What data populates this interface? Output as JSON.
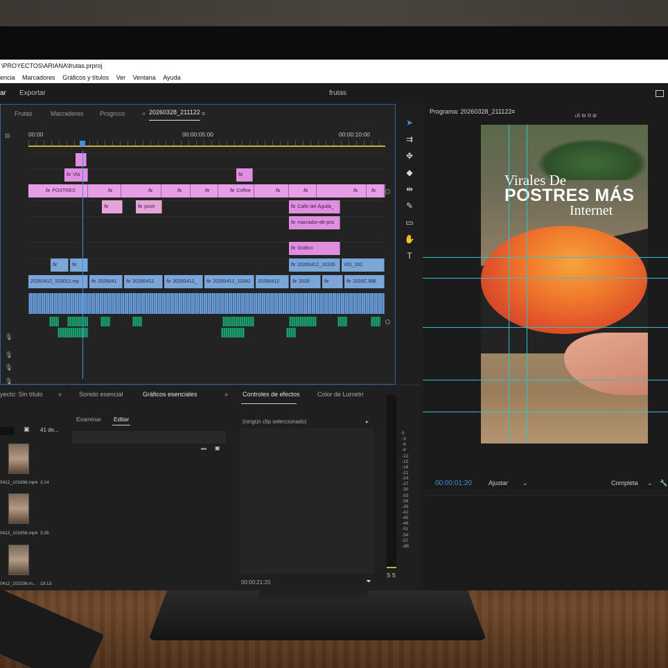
{
  "app": {
    "title_path": "\\PROYECTOS\\ARIANA\\frutas.prproj",
    "menu": [
      "encia",
      "Marcadores",
      "Gráficos y títulos",
      "Ver",
      "Ventana",
      "Ayuda"
    ],
    "modes": [
      "ar",
      "Exportar"
    ],
    "project_name": "frutas"
  },
  "timeline": {
    "tabs": [
      "Frutas",
      "Macraderes",
      "Progrcco"
    ],
    "active_tab": "20260328_211122",
    "menu_glyph": "≡",
    "timecodes": [
      "00:00",
      "00:00:05:00",
      "00:00:10:00"
    ],
    "clips": {
      "v_pink_a": "Vla",
      "v_main_1": "POSTRES",
      "v_main_2": "Coffee",
      "v_post": "postr",
      "v_calle": "Calle del Águila_",
      "v_marcador": "marcador-de-pos",
      "v_grafico": "Gráfico",
      "v_clip_a": "20260412_10165",
      "v_clip_b": "VID_202",
      "v_base_1": "20260412_103012.mp",
      "v_base_2": "2026041",
      "v_base_3": "20260412",
      "v_base_4": "20260412_",
      "v_base_5": "20260412_10342",
      "v_base_6": "20260412",
      "v_base_7": "2026",
      "v_base_8": "2026C BlB"
    },
    "fx_label": "fx"
  },
  "program": {
    "title": "Programa: 20260328_211122",
    "menu_glyph": "≡",
    "top_labels": "ʟE ₪     !0 ₪",
    "overlay_line1": "Virales De",
    "overlay_line2": "POSTRES MÁS",
    "overlay_line3": "Internet",
    "timecode": "00:00:01:20",
    "fit": "Ajustar",
    "resolution": "Completa"
  },
  "project_panel": {
    "title": "yecto: Sin título",
    "count": "41 de...",
    "items": [
      {
        "name": "0412_101698.mp4",
        "duration": "3:14"
      },
      {
        "name": "0412_101856.mp4",
        "duration": "3:26"
      },
      {
        "name": "0412_102338.m...",
        "duration": "19:13"
      }
    ]
  },
  "essential_panel": {
    "tabs": [
      "Sonido esencial",
      "Gráficos esenciales"
    ],
    "subtabs": [
      "Examinar",
      "Editar"
    ]
  },
  "effects_panel": {
    "tabs": [
      "Controles de efectos",
      "Color de Lumetri"
    ],
    "no_clip": "(ningún clip seleccionado)",
    "timecode": "00:00:21:20"
  },
  "meter": {
    "scale": [
      "0",
      "-3",
      "-6",
      "-9",
      "-12",
      "-15",
      "-18",
      "-21",
      "-24",
      "-27",
      "-30",
      "-33",
      "-36",
      "-39",
      "-42",
      "-45",
      "-48",
      "-51",
      "-54",
      "-57",
      "-dB"
    ],
    "footer": "S S"
  },
  "colors": {
    "accent": "#3d8fe8",
    "guides": "#31c2cf",
    "graphic_clip": "#e08fe0",
    "video_clip": "#7aa6d8",
    "audio_clip": "#1e9c70"
  }
}
